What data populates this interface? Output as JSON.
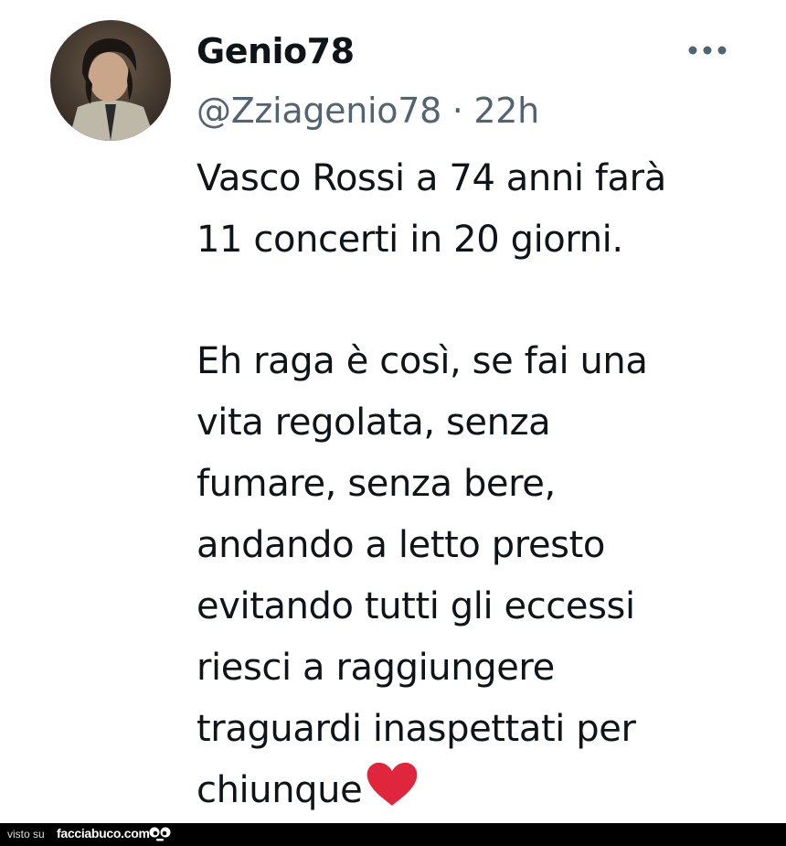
{
  "tweet": {
    "display_name": "Genio78",
    "handle": "@Zziagenio78",
    "separator": "·",
    "time": "22h",
    "paragraphs": [
      [
        "Vasco Rossi a 74 anni farà",
        "11 concerti in 20 giorni."
      ],
      [
        "Eh raga è così, se fai una",
        "vita regolata, senza",
        "fumare, senza bere,",
        "andando a letto presto",
        "evitando tutti gli eccessi",
        "riesci a raggiungere",
        "traguardi inaspettati per",
        "chiunque"
      ]
    ],
    "trailing_emoji": "heart-icon"
  },
  "footer": {
    "prefix": "visto su",
    "site": "facciabuco.com",
    "logo": "facciabuco-face-logo"
  },
  "colors": {
    "text_primary": "#0f1419",
    "text_secondary": "#536471",
    "heart": "#e0263d",
    "footer_bg": "#000000"
  }
}
